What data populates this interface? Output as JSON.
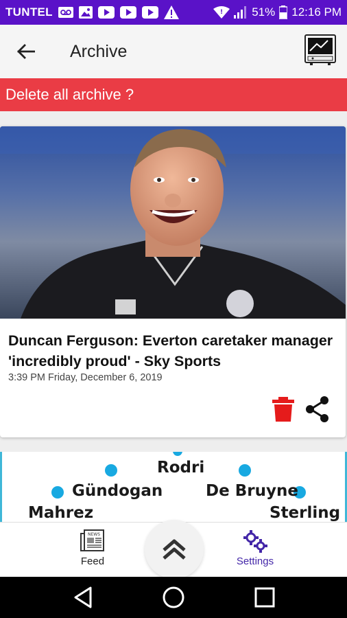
{
  "status_bar": {
    "carrier": "TUNTEL",
    "battery": "51%",
    "time": "12:16 PM"
  },
  "app_bar": {
    "title": "Archive"
  },
  "banner": {
    "text": "Delete all archive ?"
  },
  "article": {
    "title": "Duncan Ferguson: Everton caretaker manager 'incredibly proud' - Sky Sports",
    "date": "3:39 PM Friday, December 6, 2019",
    "image_desc": "smiling-coach-photo"
  },
  "preview_card": {
    "players": [
      "Rodri",
      "Gündogan",
      "De Bruyne",
      "Mahrez",
      "Sterling"
    ]
  },
  "bottom_nav": {
    "feed_label": "Feed",
    "settings_label": "Settings"
  },
  "colors": {
    "status_bar": "#5a12c8",
    "banner": "#ea3c45",
    "delete_icon": "#e51b1b",
    "settings_accent": "#4326a8",
    "player_dot": "#18a9e1"
  }
}
